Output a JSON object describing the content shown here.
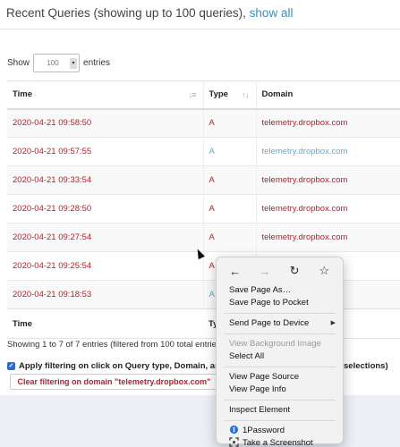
{
  "header": {
    "title": "Recent Queries (showing up to 100 queries),",
    "link": "show all"
  },
  "length_control": {
    "prefix": "Show",
    "value": "100",
    "suffix": "entries"
  },
  "table": {
    "columns": [
      "Time",
      "Type",
      "Domain"
    ],
    "rows": [
      {
        "time": "2020-04-21 09:58:50",
        "type": "A",
        "domain": "telemetry.dropbox.com",
        "cached": false
      },
      {
        "time": "2020-04-21 09:57:55",
        "type": "A",
        "domain": "telemetry.dropbox.com",
        "cached": true
      },
      {
        "time": "2020-04-21 09:33:54",
        "type": "A",
        "domain": "telemetry.dropbox.com",
        "cached": false
      },
      {
        "time": "2020-04-21 09:28:50",
        "type": "A",
        "domain": "telemetry.dropbox.com",
        "cached": false
      },
      {
        "time": "2020-04-21 09:27:54",
        "type": "A",
        "domain": "telemetry.dropbox.com",
        "cached": false
      },
      {
        "time": "2020-04-21 09:25:54",
        "type": "A",
        "domain": "",
        "cached": false
      },
      {
        "time": "2020-04-21 09:18:53",
        "type": "A",
        "domain": "",
        "cached": true
      }
    ],
    "footer_columns": [
      "Time",
      "Ty"
    ]
  },
  "summary": "Showing 1 to 7 of 7 entries (filtered from 100 total entries)",
  "filter": {
    "label": "Apply filtering on click on Query type, Domain, and Cl",
    "label_tail": "selections)",
    "clear_button": "Clear filtering on domain \"telemetry.dropbox.com\""
  },
  "context_menu": {
    "nav": {
      "back": "←",
      "forward": "→",
      "reload": "↻",
      "bookmark": "☆"
    },
    "items": {
      "save_page_as": "Save Page As…",
      "save_to_pocket": "Save Page to Pocket",
      "send_to_device": "Send Page to Device",
      "view_bg_image": "View Background Image",
      "select_all": "Select All",
      "view_source": "View Page Source",
      "view_info": "View Page Info",
      "inspect": "Inspect Element",
      "onepassword": "1Password",
      "screenshot": "Take a Screenshot"
    }
  },
  "colors": {
    "link": "#3c8dbc",
    "query_red": "#b0232a",
    "cached_blue": "#6aa9c4"
  }
}
